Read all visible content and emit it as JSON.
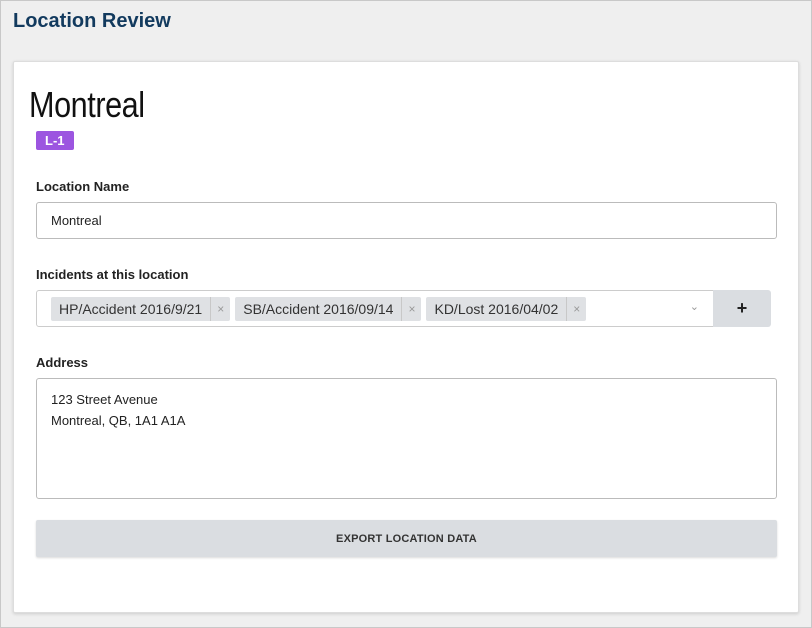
{
  "page": {
    "title": "Location Review"
  },
  "record": {
    "name": "Montreal",
    "badge": "L-1",
    "badge_color": "#9c55e0"
  },
  "fields": {
    "location_name": {
      "label": "Location Name",
      "value": "Montreal"
    },
    "incidents": {
      "label": "Incidents at this location",
      "items": [
        "HP/Accident 2016/9/21",
        "SB/Accident 2016/09/14",
        "KD/Lost 2016/04/02"
      ],
      "remove": "×",
      "dropdown": "⌄",
      "add": "+"
    },
    "address": {
      "label": "Address",
      "line1": "123 Street Avenue",
      "line2": "Montreal, QB, 1A1 A1A"
    }
  },
  "actions": {
    "export": "EXPORT LOCATION DATA"
  }
}
